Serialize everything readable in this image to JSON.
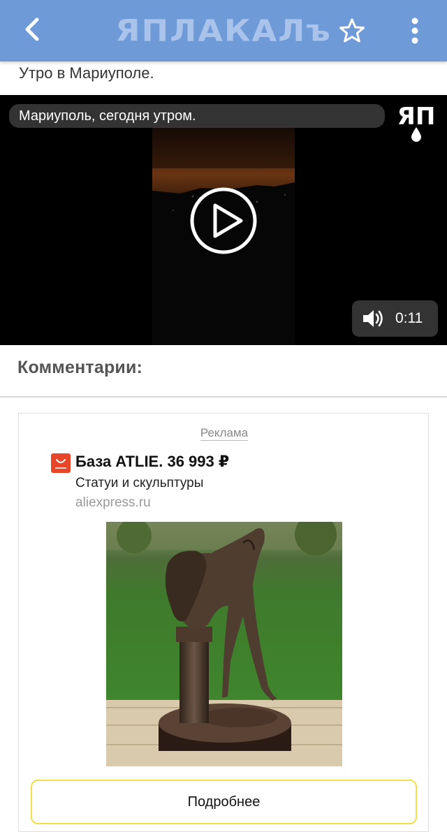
{
  "header": {
    "logo_text": "ЯПЛАКАЛъ",
    "back_icon": "chevron-left-icon",
    "favorite_icon": "star-outline-icon",
    "menu_icon": "more-vertical-icon",
    "bar_color": "#6e9bd8"
  },
  "post": {
    "title": "Утро в Мариуполе."
  },
  "video": {
    "caption": "Мариуполь, сегодня утром.",
    "watermark_icon": "yap-logo-icon",
    "play_icon": "play-icon",
    "volume_icon": "volume-icon",
    "duration": "0:11"
  },
  "comments": {
    "heading": "Комментарии:"
  },
  "ad": {
    "label": "Реклама",
    "shop_icon": "aliexpress-icon",
    "title": "База ATLIE. 36 993 ₽",
    "subtitle": "Статуи и скульптуры",
    "domain": "aliexpress.ru",
    "button_label": "Подробнее",
    "button_border_color": "#f0e04a"
  }
}
